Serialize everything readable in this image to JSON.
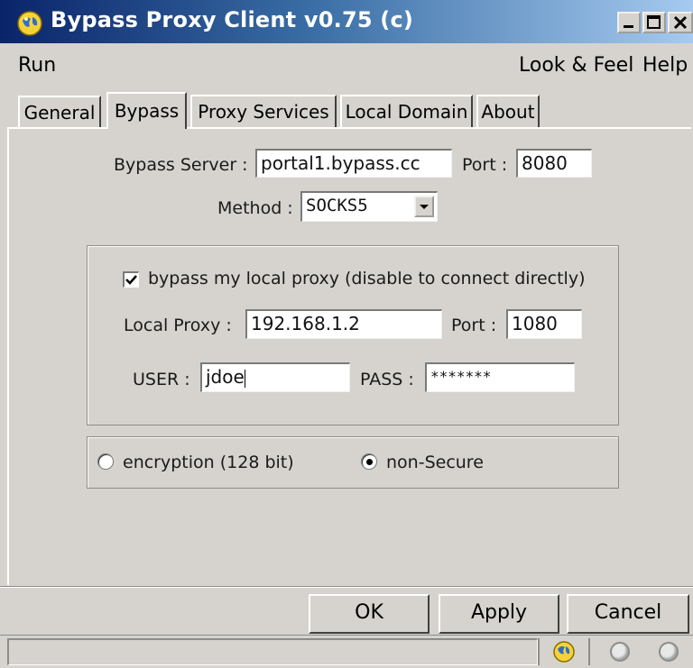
{
  "window": {
    "title": "Bypass Proxy Client v0.75 (c)"
  },
  "menu": {
    "run": "Run",
    "look_feel": "Look & Feel",
    "help": "Help"
  },
  "tabs": [
    {
      "label": "General"
    },
    {
      "label": "Bypass",
      "active": true
    },
    {
      "label": "Proxy Services"
    },
    {
      "label": "Local Domain"
    },
    {
      "label": "About"
    }
  ],
  "bypass": {
    "server_label": "Bypass Server :",
    "server_value": "portal1.bypass.cc",
    "port_label": "Port :",
    "port_value": "8080",
    "method_label": "Method :",
    "method_value": "SOCKS5"
  },
  "local": {
    "checkbox_label": "bypass my local proxy (disable to connect directly)",
    "checkbox_checked": true,
    "proxy_label": "Local Proxy :",
    "proxy_value": "192.168.1.2",
    "port_label": "Port :",
    "port_value": "1080",
    "user_label": "USER :",
    "user_value": "jdoe",
    "pass_label": "PASS :",
    "pass_value": "*******"
  },
  "security": {
    "encryption_label": "encryption (128  bit)",
    "nonsecure_label": "non-Secure",
    "selected": "non-Secure"
  },
  "buttons": {
    "ok": "OK",
    "apply": "Apply",
    "cancel": "Cancel"
  },
  "colors": {
    "face": "#d6d3ce",
    "title_start": "#0a246a",
    "title_end": "#a6caf0"
  },
  "icons": {
    "app": "globe-bulb-icon",
    "status": "globe-bulb-icon"
  }
}
